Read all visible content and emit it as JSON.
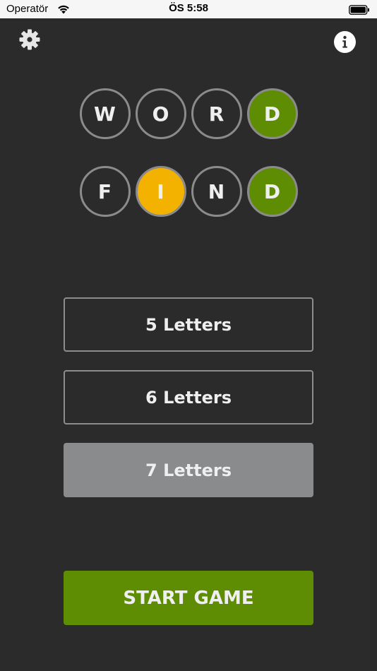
{
  "status_bar": {
    "carrier": "Operatör",
    "time": "ÖS 5:58",
    "icons": [
      "wifi-icon",
      "battery-icon"
    ]
  },
  "header": {
    "settings_icon": "gear-icon",
    "info_icon": "info-icon"
  },
  "logo": {
    "row1": [
      "W",
      "O",
      "R",
      "D"
    ],
    "row2": [
      "F",
      "I",
      "N",
      "D"
    ]
  },
  "colors": {
    "background": "#2b2b2b",
    "tile_border": "#8b8b8b",
    "green": "#5e8d04",
    "yellow": "#f3b100",
    "selected_option": "#8a8b8d"
  },
  "options": {
    "five": "5 Letters",
    "six": "6 Letters",
    "seven": "7 Letters",
    "selected": "7 Letters"
  },
  "start_button": "START GAME"
}
